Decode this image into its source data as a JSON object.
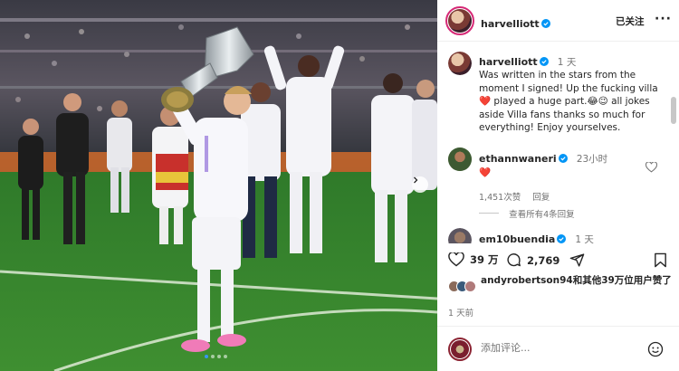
{
  "post": {
    "author": "harvelliott",
    "follow_state": "已关注",
    "caption_time": "1 天",
    "caption": "Was written in the stars from the moment I signed! Up the fucking villa ❤️ played a huge part.😂😉 all jokes aside Villa fans thanks so much for everything! Enjoy yourselves."
  },
  "comments": [
    {
      "user": "ethannwaneri",
      "time": "23小时",
      "text": "❤️",
      "likes": "1,451次赞",
      "reply_label": "回复",
      "view_replies": "查看所有4条回复"
    },
    {
      "user": "em10buendia",
      "time": "1 天"
    }
  ],
  "actions": {
    "like_count": "39 万",
    "comment_count": "2,769"
  },
  "liked_by_text": "andyrobertson94和其他39万位用户赞了",
  "posted_ago": "1 天前",
  "comment_placeholder": "添加评论...",
  "icons": {
    "verified": "verified-badge-icon",
    "more": "more-icon",
    "like": "heart-icon",
    "comment": "comment-icon",
    "share": "share-icon",
    "save": "bookmark-icon",
    "emoji": "emoji-icon",
    "carousel_next": "chevron-right-icon"
  },
  "colors": {
    "verified_blue": "#0095f6",
    "heart_red": "#ed4956",
    "secondary_text": "#737373",
    "story_ring": "#d62976"
  }
}
